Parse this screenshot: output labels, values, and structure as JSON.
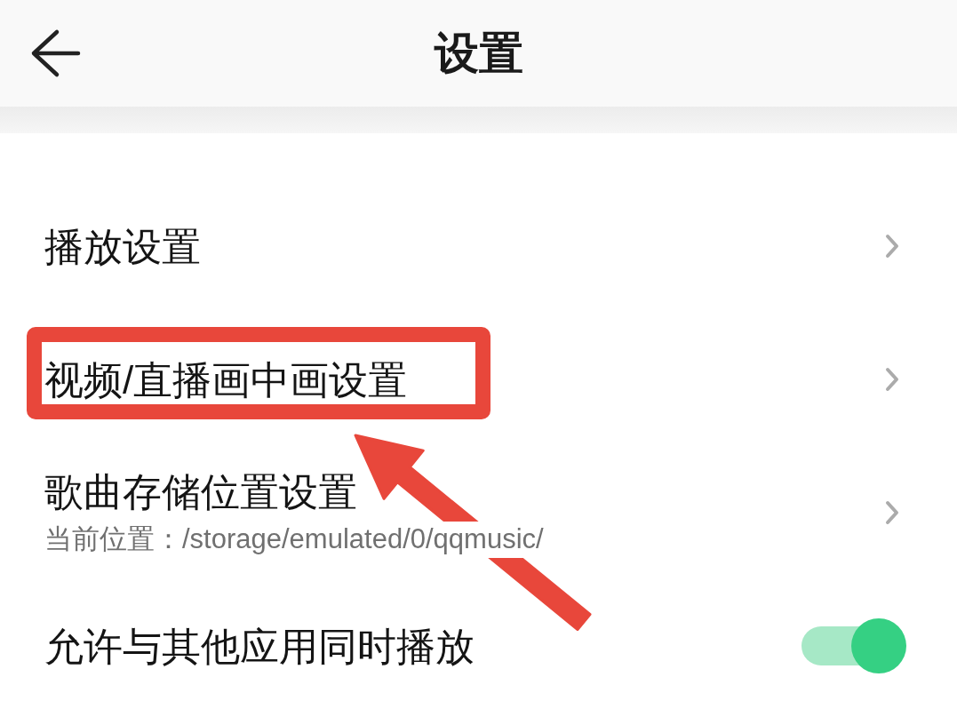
{
  "header": {
    "title": "设置"
  },
  "items": [
    {
      "kind": "nav",
      "label": "播放设置",
      "highlighted": false
    },
    {
      "kind": "nav",
      "label": "视频/直播画中画设置",
      "highlighted": true
    },
    {
      "kind": "nav",
      "label": "歌曲存储位置设置",
      "detail": "当前位置：/storage/emulated/0/qqmusic/",
      "highlighted": false
    },
    {
      "kind": "toggle",
      "label": "允许与其他应用同时播放",
      "on": true,
      "highlighted": false
    }
  ]
}
